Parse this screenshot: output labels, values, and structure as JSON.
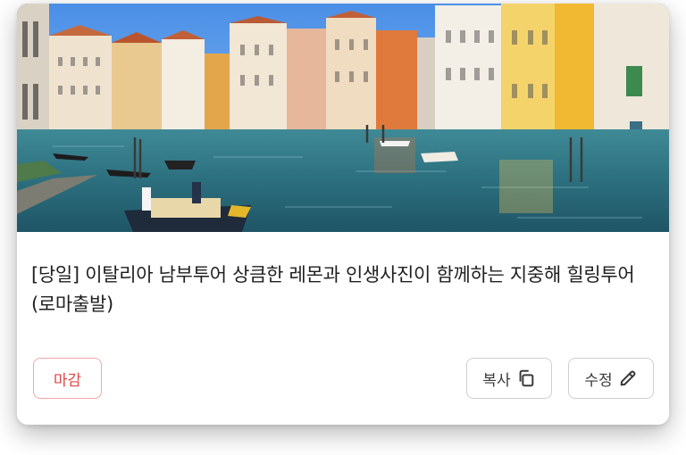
{
  "listing": {
    "title": "[당일] 이탈리아 남부투어 상큼한 레몬과 인생사진이 함께하는 지중해 힐링투어(로마출발)",
    "image_alt": "Venice grand canal with gondolas and colorful buildings"
  },
  "status_badge": {
    "label": "마감",
    "color": "#e04848"
  },
  "actions": {
    "copy_label": "복사",
    "copy_icon": "copy-icon",
    "edit_label": "수정",
    "edit_icon": "pencil-icon"
  }
}
